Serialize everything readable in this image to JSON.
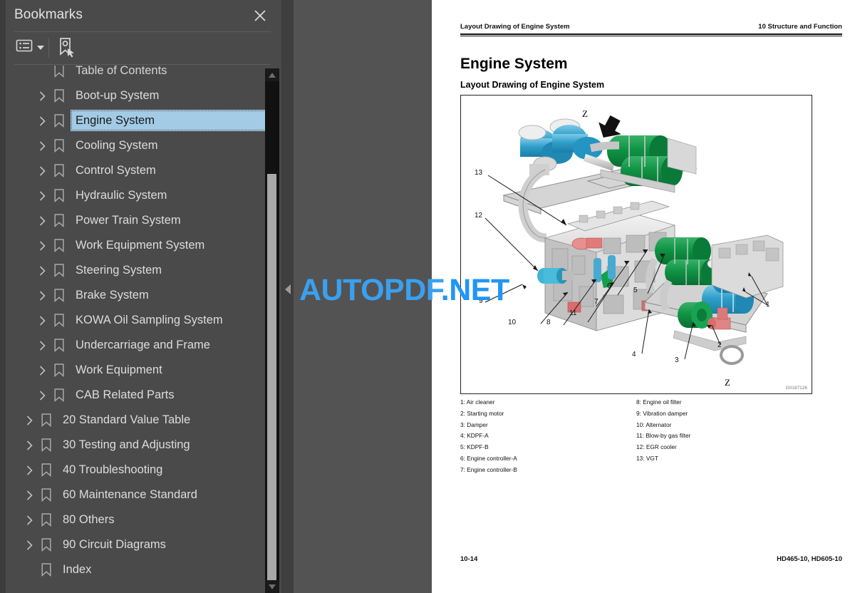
{
  "panel": {
    "title": "Bookmarks",
    "close_icon": "close-icon",
    "toolbar": {
      "list_options_icon": "list-options-icon",
      "caret_icon": "chevron-down-icon",
      "new_bookmark_icon": "new-bookmark-icon"
    },
    "items": [
      {
        "label": "Table of Contents",
        "level": 1,
        "expandable": false,
        "selected": false,
        "partial": true
      },
      {
        "label": "Boot-up System",
        "level": 1,
        "expandable": true,
        "selected": false
      },
      {
        "label": "Engine System",
        "level": 1,
        "expandable": true,
        "selected": true
      },
      {
        "label": "Cooling System",
        "level": 1,
        "expandable": true,
        "selected": false
      },
      {
        "label": "Control System",
        "level": 1,
        "expandable": true,
        "selected": false
      },
      {
        "label": "Hydraulic System",
        "level": 1,
        "expandable": true,
        "selected": false
      },
      {
        "label": "Power Train System",
        "level": 1,
        "expandable": true,
        "selected": false
      },
      {
        "label": "Work Equipment System",
        "level": 1,
        "expandable": true,
        "selected": false
      },
      {
        "label": "Steering System",
        "level": 1,
        "expandable": true,
        "selected": false
      },
      {
        "label": "Brake System",
        "level": 1,
        "expandable": true,
        "selected": false
      },
      {
        "label": "KOWA Oil Sampling System",
        "level": 1,
        "expandable": true,
        "selected": false
      },
      {
        "label": "Undercarriage and Frame",
        "level": 1,
        "expandable": true,
        "selected": false
      },
      {
        "label": "Work Equipment",
        "level": 1,
        "expandable": true,
        "selected": false
      },
      {
        "label": "CAB Related Parts",
        "level": 1,
        "expandable": true,
        "selected": false
      },
      {
        "label": "20 Standard Value Table",
        "level": 0,
        "expandable": true,
        "selected": false
      },
      {
        "label": "30 Testing and Adjusting",
        "level": 0,
        "expandable": true,
        "selected": false
      },
      {
        "label": "40 Troubleshooting",
        "level": 0,
        "expandable": true,
        "selected": false
      },
      {
        "label": "60 Maintenance Standard",
        "level": 0,
        "expandable": true,
        "selected": false
      },
      {
        "label": "80 Others",
        "level": 0,
        "expandable": true,
        "selected": false
      },
      {
        "label": "90 Circuit Diagrams",
        "level": 0,
        "expandable": true,
        "selected": false
      },
      {
        "label": "Index",
        "level": 0,
        "expandable": false,
        "selected": false
      }
    ]
  },
  "viewer": {
    "collapse_handle_icon": "collapse-left-icon",
    "watermark": {
      "part1": "AUTOPDF",
      "part2": ".NET"
    }
  },
  "document": {
    "header_left": "Layout Drawing of Engine System",
    "header_right": "10 Structure and Function",
    "heading": "Engine System",
    "subheading": "Layout Drawing of Engine System",
    "figure": {
      "id": "G0187126",
      "view_arrow_label": "Z",
      "detail_view_label": "Z",
      "callouts": [
        "13",
        "12",
        "9",
        "10",
        "8",
        "11",
        "7",
        "6",
        "5",
        "4",
        "3",
        "2",
        "1"
      ]
    },
    "legend": {
      "left": [
        "1: Air cleaner",
        "2: Starting motor",
        "3: Damper",
        "4: KDPF-A",
        "5: KDPF-B",
        "6: Engine controller-A",
        "7: Engine controller-B"
      ],
      "right": [
        "8: Engine oil filter",
        "9: Vibration damper",
        "10: Alternator",
        "11: Blow-by gas filter",
        "12: EGR cooler",
        "13: VGT"
      ]
    },
    "footer_left": "10-14",
    "footer_right": "HD465-10, HD605-10"
  }
}
